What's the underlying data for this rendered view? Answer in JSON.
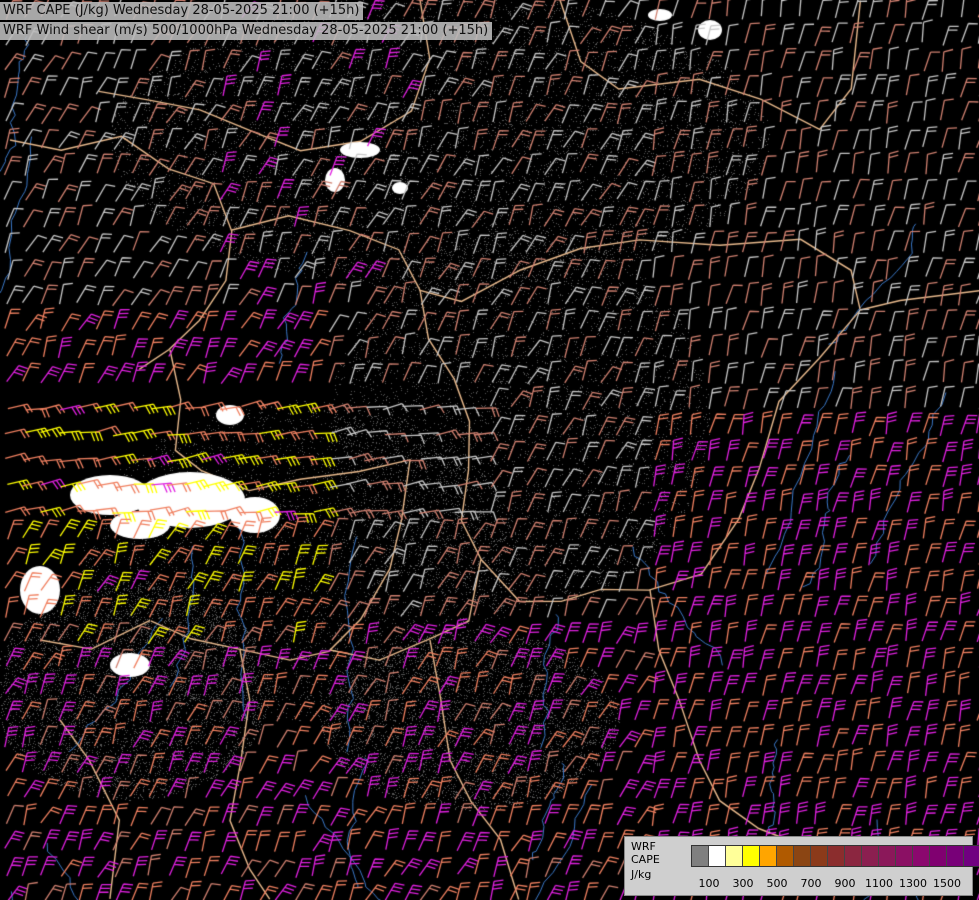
{
  "titles": {
    "line1": "WRF CAPE (J/kg) Wednesday 28-05-2025 21:00 (+15h)",
    "line2": "WRF Wind shear (m/s) 500/1000hPa Wednesday 28-05-2025 21:00 (+15h)"
  },
  "legend": {
    "caption_line1": "WRF",
    "caption_line2": "CAPE",
    "caption_line3": "J/kg",
    "colors": [
      "#7f7f7f",
      "#ffffff",
      "#ffff99",
      "#ffff00",
      "#ffa500",
      "#b05a00",
      "#8b4513",
      "#8b3a1a",
      "#8b2d2d",
      "#8b2640",
      "#8b1f50",
      "#8b185a",
      "#8b1064",
      "#8b086e",
      "#800070",
      "#780078",
      "#700080"
    ],
    "tick_labels": [
      "100",
      "300",
      "500",
      "700",
      "900",
      "1100",
      "1300",
      "1500"
    ]
  },
  "map": {
    "colors": {
      "background": "#000000",
      "stipple": "#555555",
      "border": "#e8b98c",
      "river": "#3a78c8",
      "barb_low": "#c8c8c8",
      "barb_mid": "#d08070",
      "barb_orange": "#f08060",
      "barb_high": "#e020e0",
      "barb_extreme": "#ffff00",
      "cape_patch": "#ffffff"
    }
  }
}
